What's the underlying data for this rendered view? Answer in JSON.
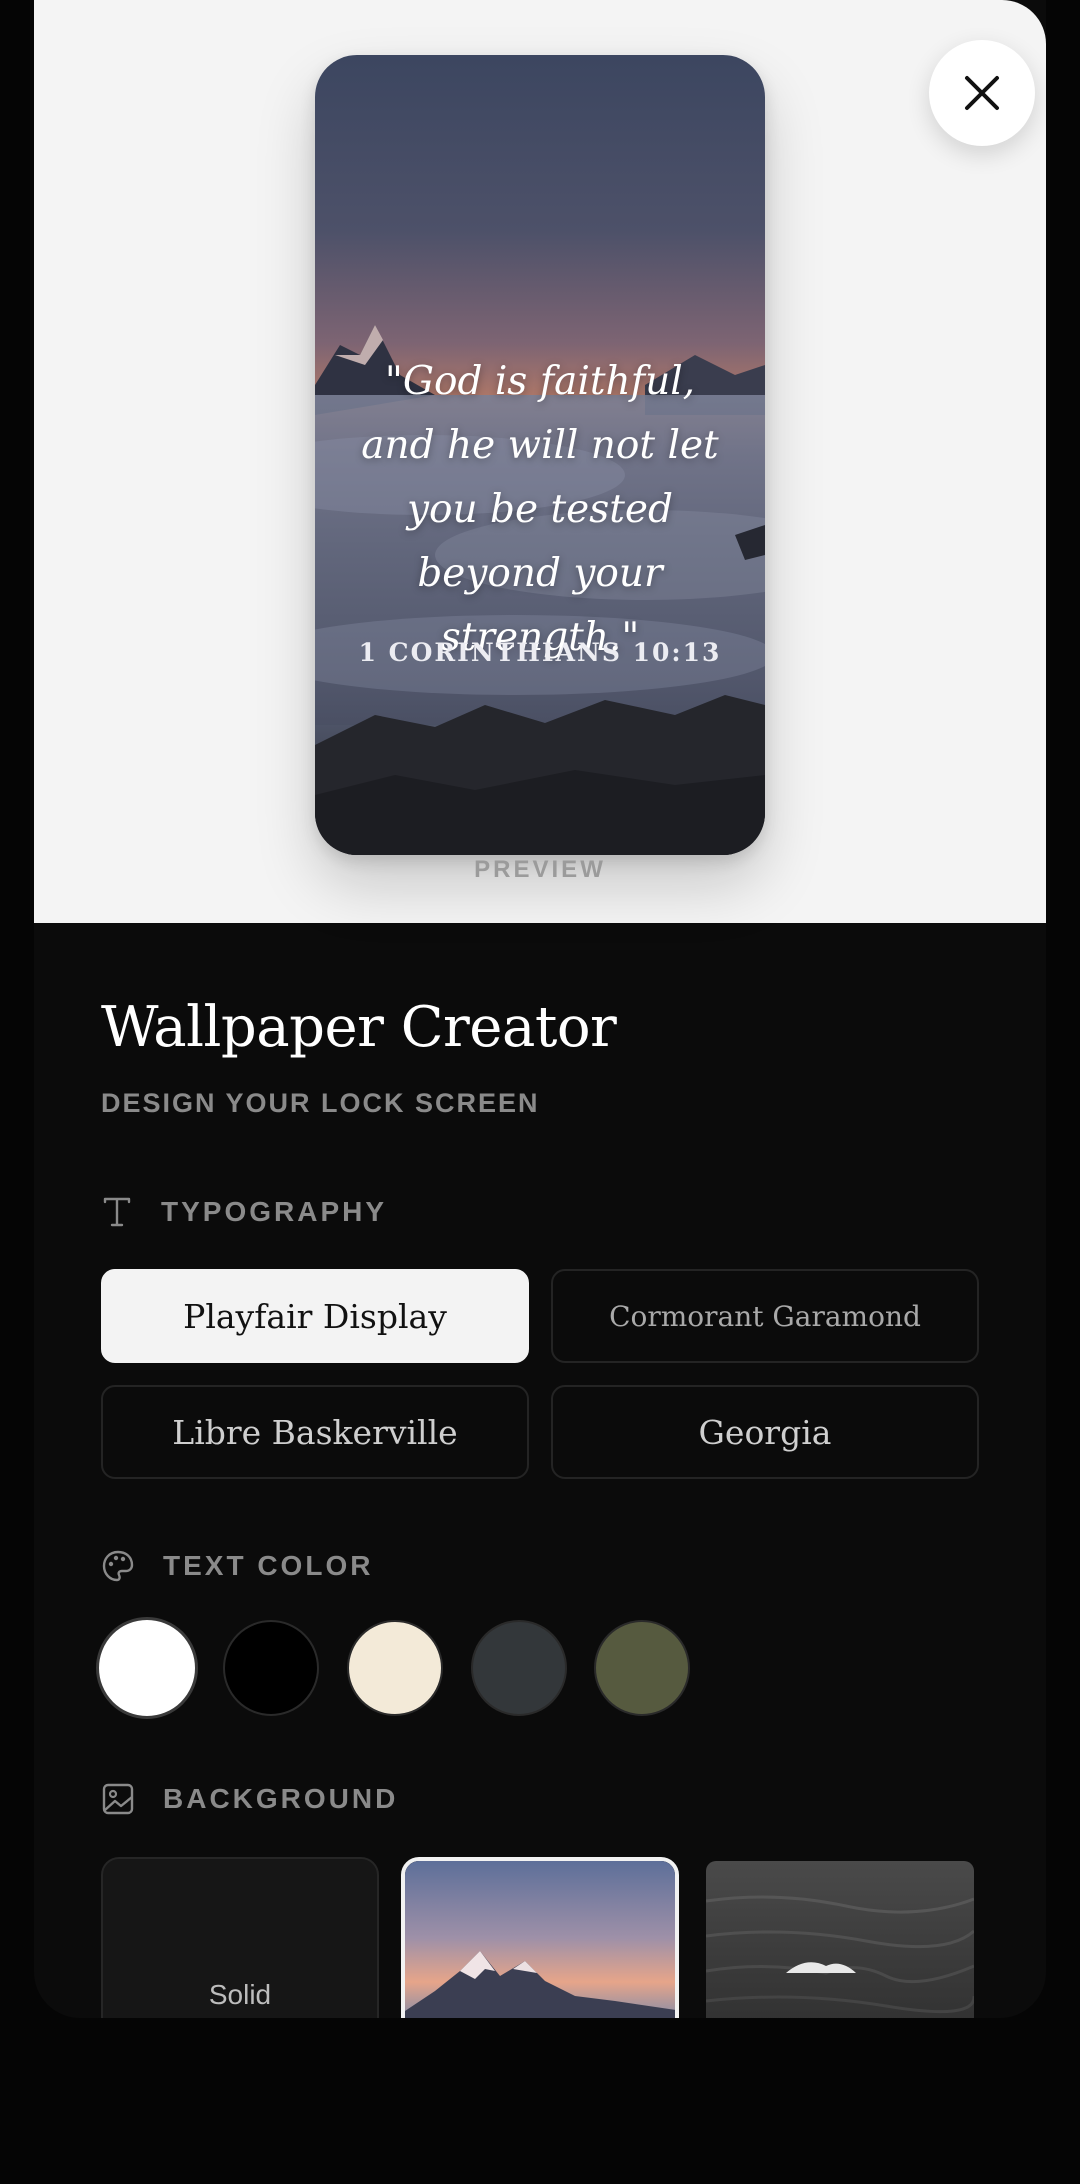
{
  "preview": {
    "quote": "\"God is faithful, and he will not let you be tested beyond your strength.\"",
    "reference": "1 CORINTHIANS 10:13",
    "label": "PREVIEW"
  },
  "header": {
    "title": "Wallpaper Creator",
    "subtitle": "DESIGN YOUR LOCK SCREEN"
  },
  "typography": {
    "label": "TYPOGRAPHY",
    "fonts": [
      "Playfair Display",
      "Cormorant Garamond",
      "Libre Baskerville",
      "Georgia"
    ],
    "selected": "Playfair Display"
  },
  "text_color": {
    "label": "TEXT COLOR",
    "swatches": [
      "#ffffff",
      "#000000",
      "#f3ead8",
      "#33373a",
      "#565a3f"
    ],
    "selected": "#ffffff"
  },
  "background": {
    "label": "BACKGROUND",
    "options": [
      "Solid"
    ],
    "selected": "mountain"
  },
  "icons": {
    "close": "close-icon",
    "typography": "type-icon",
    "color": "palette-icon",
    "background": "image-icon"
  }
}
